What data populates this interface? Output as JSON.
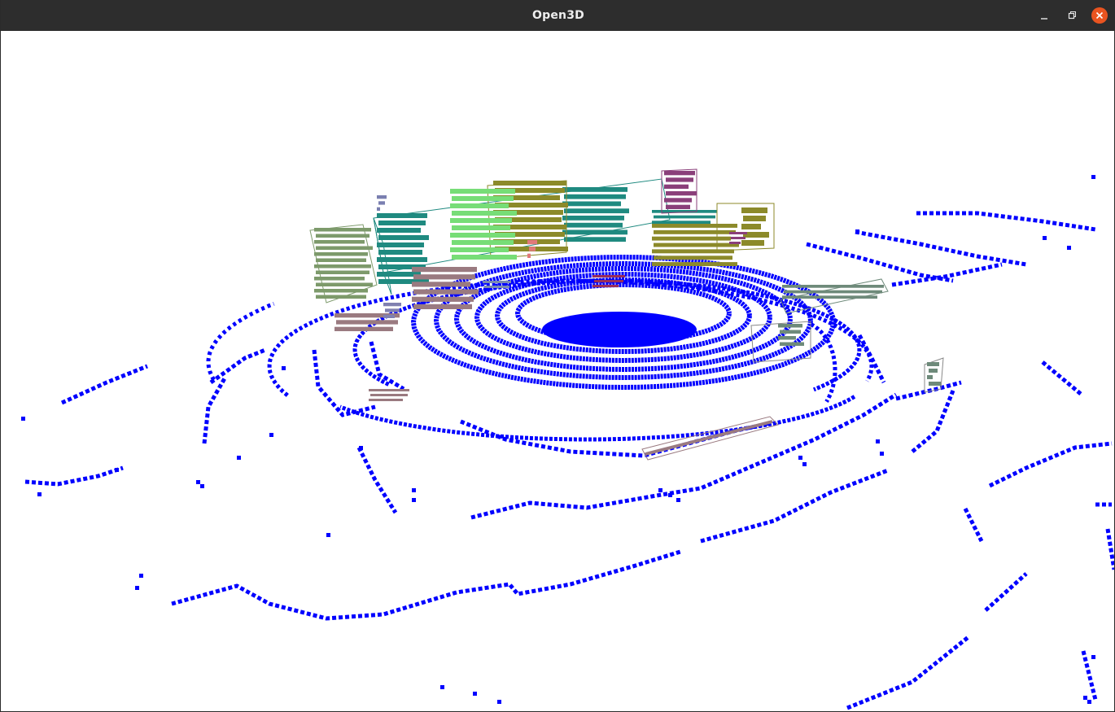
{
  "window": {
    "title": "Open3D",
    "controls": {
      "minimize_icon": "minimize-icon",
      "maximize_icon": "maximize-icon",
      "close_icon": "close-icon"
    }
  },
  "colors": {
    "titlebar": "#2d2d2d",
    "close_button": "#e95420",
    "ground_points": "#0000ff",
    "background": "#ffffff",
    "cluster_teal": "#1f8a80",
    "cluster_olive": "#8c8a2a",
    "cluster_green": "#77dd77",
    "cluster_sage": "#7d9a6b",
    "cluster_magenta": "#8a3f7a",
    "cluster_mauve": "#9a7a80",
    "cluster_slate": "#6e8a7a",
    "cluster_pink": "#e07a7a",
    "cluster_maroon": "#9a2d5a"
  }
}
